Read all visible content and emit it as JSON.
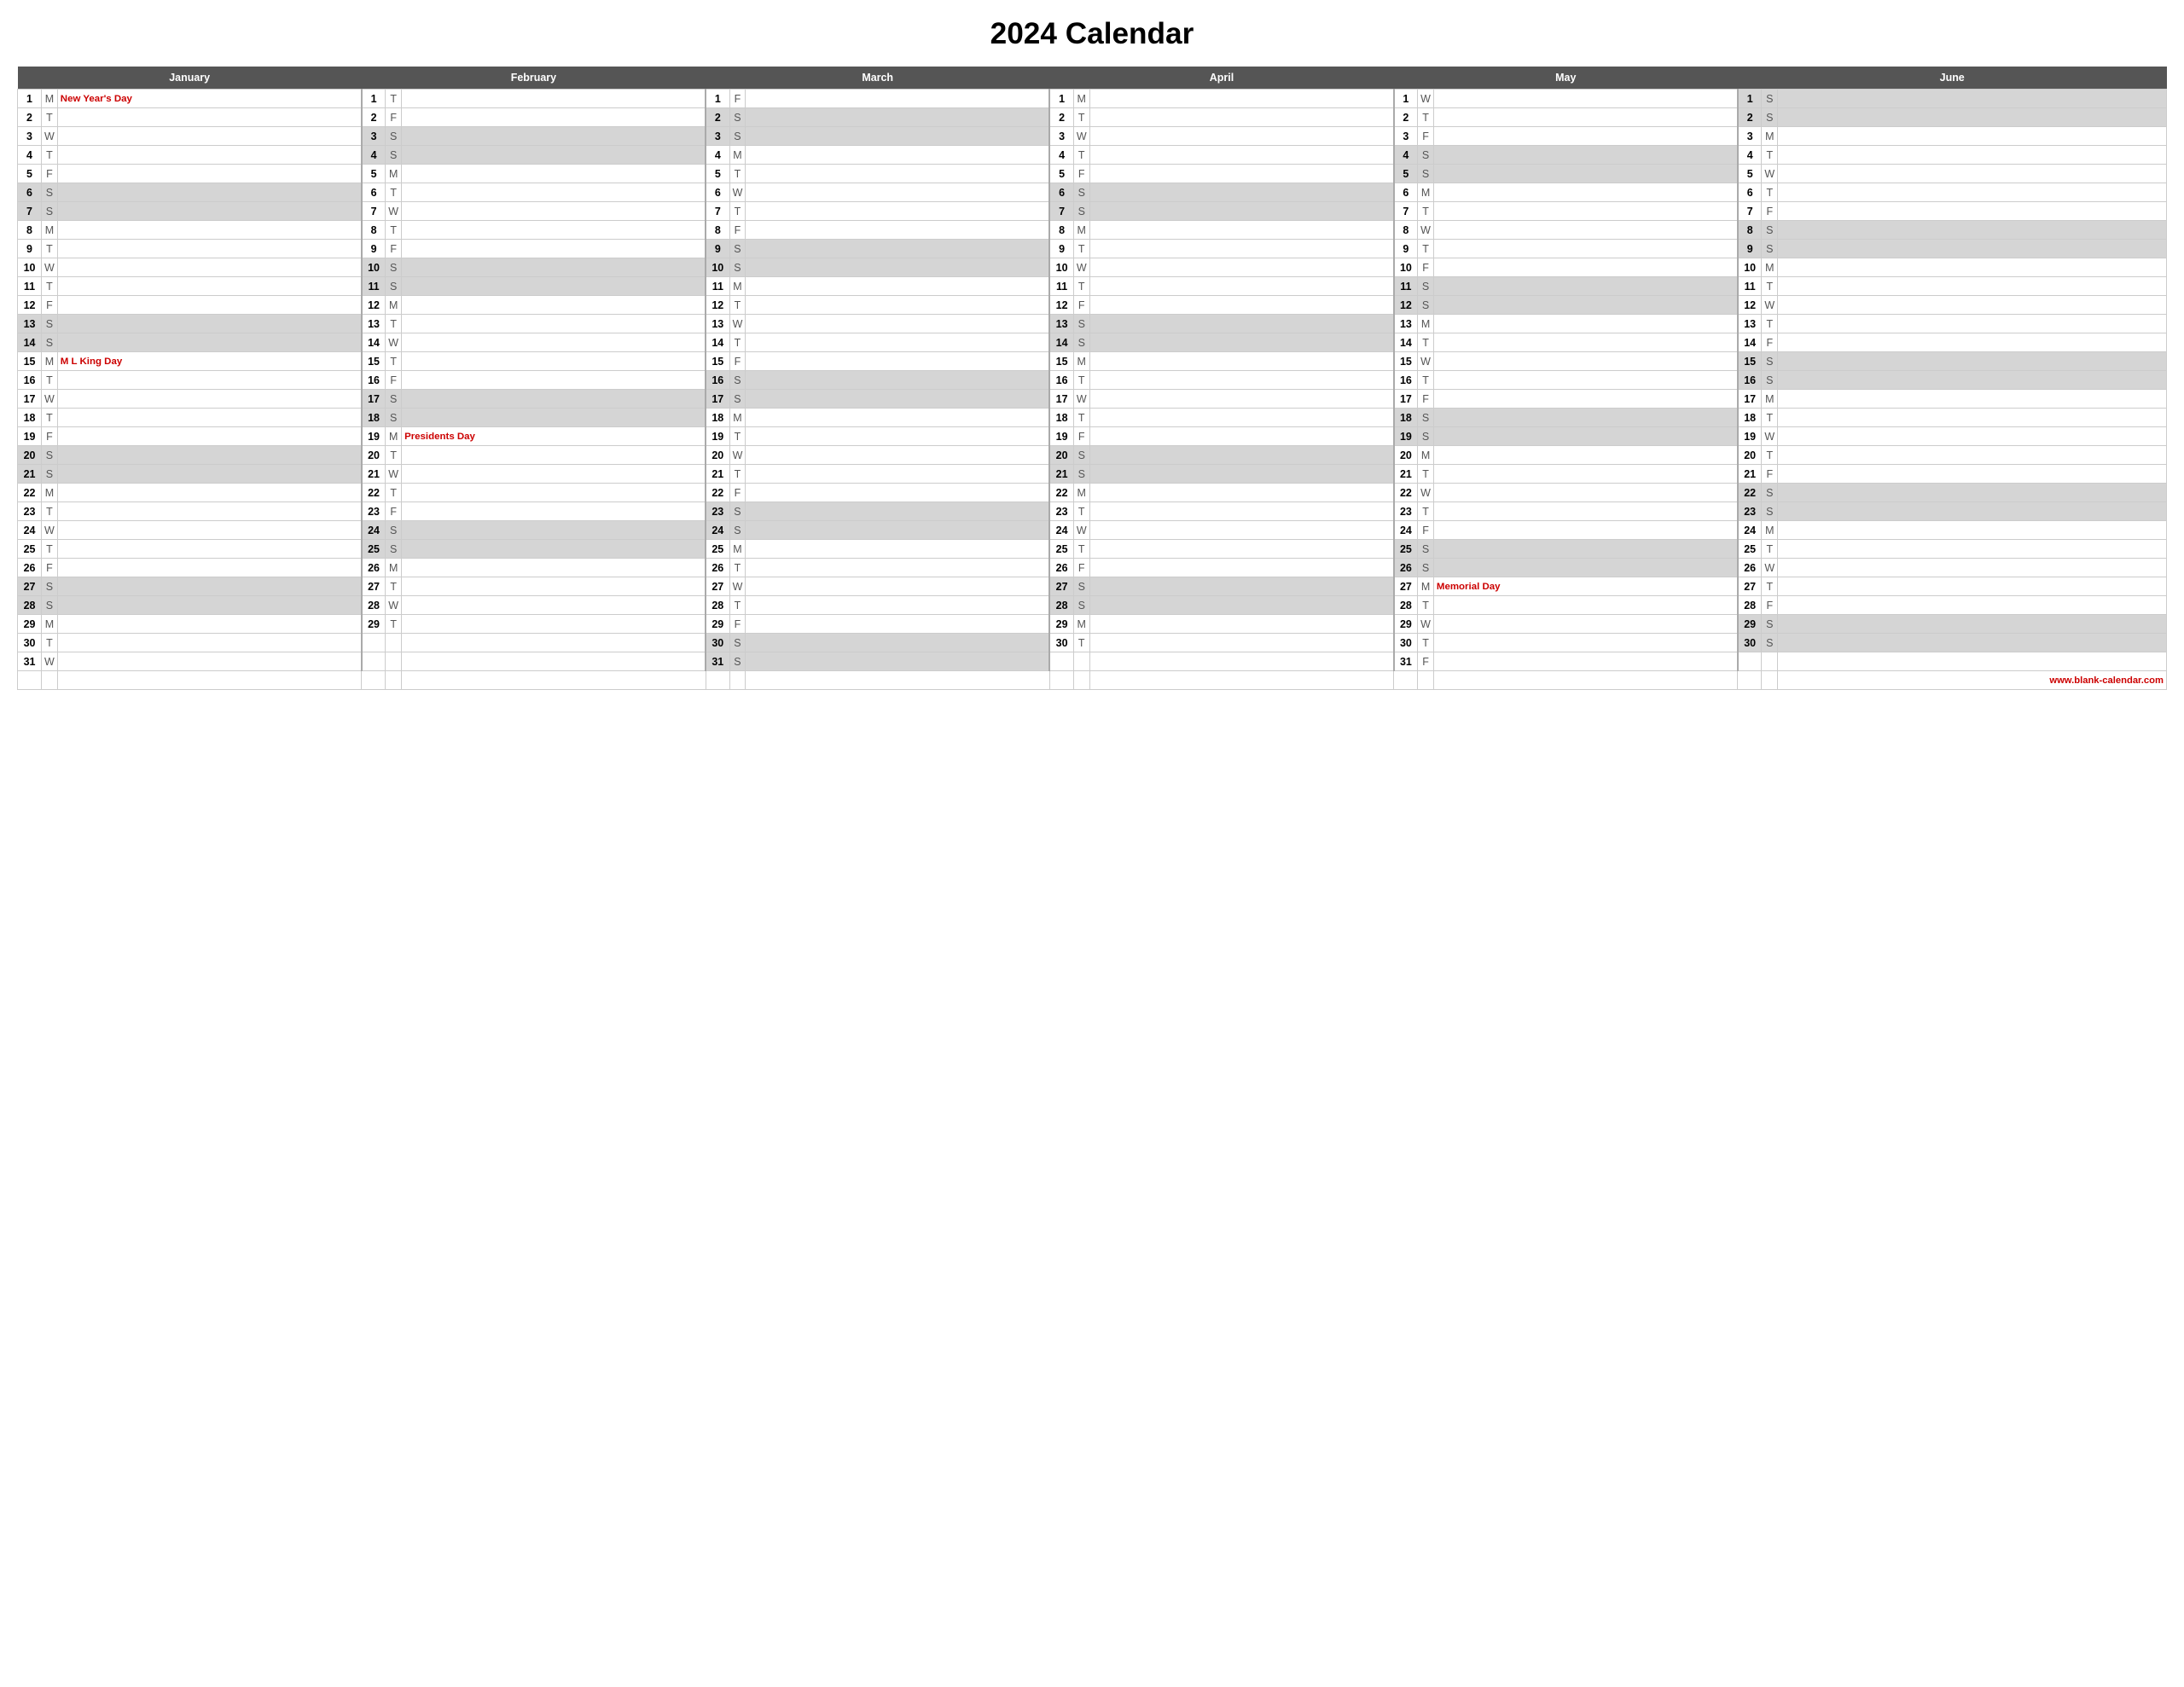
{
  "title": "2024 Calendar",
  "website": "www.blank-calendar.com",
  "months": [
    "January",
    "February",
    "March",
    "April",
    "May",
    "June"
  ],
  "holidays": {
    "jan_1": "New Year's Day",
    "jan_15": "M L King Day",
    "feb_19": "Presidents Day",
    "may_27": "Memorial Day"
  },
  "days": {
    "january": [
      {
        "d": 1,
        "wd": "M",
        "holiday": "New Year's Day",
        "weekend": false
      },
      {
        "d": 2,
        "wd": "T",
        "holiday": "",
        "weekend": false
      },
      {
        "d": 3,
        "wd": "W",
        "holiday": "",
        "weekend": false
      },
      {
        "d": 4,
        "wd": "T",
        "holiday": "",
        "weekend": false
      },
      {
        "d": 5,
        "wd": "F",
        "holiday": "",
        "weekend": false
      },
      {
        "d": 6,
        "wd": "S",
        "holiday": "",
        "weekend": true
      },
      {
        "d": 7,
        "wd": "S",
        "holiday": "",
        "weekend": true
      },
      {
        "d": 8,
        "wd": "M",
        "holiday": "",
        "weekend": false
      },
      {
        "d": 9,
        "wd": "T",
        "holiday": "",
        "weekend": false
      },
      {
        "d": 10,
        "wd": "W",
        "holiday": "",
        "weekend": false
      },
      {
        "d": 11,
        "wd": "T",
        "holiday": "",
        "weekend": false
      },
      {
        "d": 12,
        "wd": "F",
        "holiday": "",
        "weekend": false
      },
      {
        "d": 13,
        "wd": "S",
        "holiday": "",
        "weekend": true
      },
      {
        "d": 14,
        "wd": "S",
        "holiday": "",
        "weekend": true
      },
      {
        "d": 15,
        "wd": "M",
        "holiday": "M L King Day",
        "weekend": false
      },
      {
        "d": 16,
        "wd": "T",
        "holiday": "",
        "weekend": false
      },
      {
        "d": 17,
        "wd": "W",
        "holiday": "",
        "weekend": false
      },
      {
        "d": 18,
        "wd": "T",
        "holiday": "",
        "weekend": false
      },
      {
        "d": 19,
        "wd": "F",
        "holiday": "",
        "weekend": false
      },
      {
        "d": 20,
        "wd": "S",
        "holiday": "",
        "weekend": true
      },
      {
        "d": 21,
        "wd": "S",
        "holiday": "",
        "weekend": true
      },
      {
        "d": 22,
        "wd": "M",
        "holiday": "",
        "weekend": false
      },
      {
        "d": 23,
        "wd": "T",
        "holiday": "",
        "weekend": false
      },
      {
        "d": 24,
        "wd": "W",
        "holiday": "",
        "weekend": false
      },
      {
        "d": 25,
        "wd": "T",
        "holiday": "",
        "weekend": false
      },
      {
        "d": 26,
        "wd": "F",
        "holiday": "",
        "weekend": false
      },
      {
        "d": 27,
        "wd": "S",
        "holiday": "",
        "weekend": true
      },
      {
        "d": 28,
        "wd": "S",
        "holiday": "",
        "weekend": true
      },
      {
        "d": 29,
        "wd": "M",
        "holiday": "",
        "weekend": false
      },
      {
        "d": 30,
        "wd": "T",
        "holiday": "",
        "weekend": false
      },
      {
        "d": 31,
        "wd": "W",
        "holiday": "",
        "weekend": false
      }
    ],
    "february": [
      {
        "d": 1,
        "wd": "T",
        "holiday": "",
        "weekend": false
      },
      {
        "d": 2,
        "wd": "F",
        "holiday": "",
        "weekend": false
      },
      {
        "d": 3,
        "wd": "S",
        "holiday": "",
        "weekend": true
      },
      {
        "d": 4,
        "wd": "S",
        "holiday": "",
        "weekend": true
      },
      {
        "d": 5,
        "wd": "M",
        "holiday": "",
        "weekend": false
      },
      {
        "d": 6,
        "wd": "T",
        "holiday": "",
        "weekend": false
      },
      {
        "d": 7,
        "wd": "W",
        "holiday": "",
        "weekend": false
      },
      {
        "d": 8,
        "wd": "T",
        "holiday": "",
        "weekend": false
      },
      {
        "d": 9,
        "wd": "F",
        "holiday": "",
        "weekend": false
      },
      {
        "d": 10,
        "wd": "S",
        "holiday": "",
        "weekend": true
      },
      {
        "d": 11,
        "wd": "S",
        "holiday": "",
        "weekend": true
      },
      {
        "d": 12,
        "wd": "M",
        "holiday": "",
        "weekend": false
      },
      {
        "d": 13,
        "wd": "T",
        "holiday": "",
        "weekend": false
      },
      {
        "d": 14,
        "wd": "W",
        "holiday": "",
        "weekend": false
      },
      {
        "d": 15,
        "wd": "T",
        "holiday": "",
        "weekend": false
      },
      {
        "d": 16,
        "wd": "F",
        "holiday": "",
        "weekend": false
      },
      {
        "d": 17,
        "wd": "S",
        "holiday": "",
        "weekend": true
      },
      {
        "d": 18,
        "wd": "S",
        "holiday": "",
        "weekend": true
      },
      {
        "d": 19,
        "wd": "M",
        "holiday": "Presidents Day",
        "weekend": false
      },
      {
        "d": 20,
        "wd": "T",
        "holiday": "",
        "weekend": false
      },
      {
        "d": 21,
        "wd": "W",
        "holiday": "",
        "weekend": false
      },
      {
        "d": 22,
        "wd": "T",
        "holiday": "",
        "weekend": false
      },
      {
        "d": 23,
        "wd": "F",
        "holiday": "",
        "weekend": false
      },
      {
        "d": 24,
        "wd": "S",
        "holiday": "",
        "weekend": true
      },
      {
        "d": 25,
        "wd": "S",
        "holiday": "",
        "weekend": true
      },
      {
        "d": 26,
        "wd": "M",
        "holiday": "",
        "weekend": false
      },
      {
        "d": 27,
        "wd": "T",
        "holiday": "",
        "weekend": false
      },
      {
        "d": 28,
        "wd": "W",
        "holiday": "",
        "weekend": false
      },
      {
        "d": 29,
        "wd": "T",
        "holiday": "",
        "weekend": false
      }
    ],
    "march": [
      {
        "d": 1,
        "wd": "F",
        "holiday": "",
        "weekend": false
      },
      {
        "d": 2,
        "wd": "S",
        "holiday": "",
        "weekend": true
      },
      {
        "d": 3,
        "wd": "S",
        "holiday": "",
        "weekend": true
      },
      {
        "d": 4,
        "wd": "M",
        "holiday": "",
        "weekend": false
      },
      {
        "d": 5,
        "wd": "T",
        "holiday": "",
        "weekend": false
      },
      {
        "d": 6,
        "wd": "W",
        "holiday": "",
        "weekend": false
      },
      {
        "d": 7,
        "wd": "T",
        "holiday": "",
        "weekend": false
      },
      {
        "d": 8,
        "wd": "F",
        "holiday": "",
        "weekend": false
      },
      {
        "d": 9,
        "wd": "S",
        "holiday": "",
        "weekend": true
      },
      {
        "d": 10,
        "wd": "S",
        "holiday": "",
        "weekend": true
      },
      {
        "d": 11,
        "wd": "M",
        "holiday": "",
        "weekend": false
      },
      {
        "d": 12,
        "wd": "T",
        "holiday": "",
        "weekend": false
      },
      {
        "d": 13,
        "wd": "W",
        "holiday": "",
        "weekend": false
      },
      {
        "d": 14,
        "wd": "T",
        "holiday": "",
        "weekend": false
      },
      {
        "d": 15,
        "wd": "F",
        "holiday": "",
        "weekend": false
      },
      {
        "d": 16,
        "wd": "S",
        "holiday": "",
        "weekend": true
      },
      {
        "d": 17,
        "wd": "S",
        "holiday": "",
        "weekend": true
      },
      {
        "d": 18,
        "wd": "M",
        "holiday": "",
        "weekend": false
      },
      {
        "d": 19,
        "wd": "T",
        "holiday": "",
        "weekend": false
      },
      {
        "d": 20,
        "wd": "W",
        "holiday": "",
        "weekend": false
      },
      {
        "d": 21,
        "wd": "T",
        "holiday": "",
        "weekend": false
      },
      {
        "d": 22,
        "wd": "F",
        "holiday": "",
        "weekend": false
      },
      {
        "d": 23,
        "wd": "S",
        "holiday": "",
        "weekend": true
      },
      {
        "d": 24,
        "wd": "S",
        "holiday": "",
        "weekend": true
      },
      {
        "d": 25,
        "wd": "M",
        "holiday": "",
        "weekend": false
      },
      {
        "d": 26,
        "wd": "T",
        "holiday": "",
        "weekend": false
      },
      {
        "d": 27,
        "wd": "W",
        "holiday": "",
        "weekend": false
      },
      {
        "d": 28,
        "wd": "T",
        "holiday": "",
        "weekend": false
      },
      {
        "d": 29,
        "wd": "F",
        "holiday": "",
        "weekend": false
      },
      {
        "d": 30,
        "wd": "S",
        "holiday": "",
        "weekend": true
      },
      {
        "d": 31,
        "wd": "S",
        "holiday": "",
        "weekend": true
      }
    ],
    "april": [
      {
        "d": 1,
        "wd": "M",
        "holiday": "",
        "weekend": false
      },
      {
        "d": 2,
        "wd": "T",
        "holiday": "",
        "weekend": false
      },
      {
        "d": 3,
        "wd": "W",
        "holiday": "",
        "weekend": false
      },
      {
        "d": 4,
        "wd": "T",
        "holiday": "",
        "weekend": false
      },
      {
        "d": 5,
        "wd": "F",
        "holiday": "",
        "weekend": false
      },
      {
        "d": 6,
        "wd": "S",
        "holiday": "",
        "weekend": true
      },
      {
        "d": 7,
        "wd": "S",
        "holiday": "",
        "weekend": true
      },
      {
        "d": 8,
        "wd": "M",
        "holiday": "",
        "weekend": false
      },
      {
        "d": 9,
        "wd": "T",
        "holiday": "",
        "weekend": false
      },
      {
        "d": 10,
        "wd": "W",
        "holiday": "",
        "weekend": false
      },
      {
        "d": 11,
        "wd": "T",
        "holiday": "",
        "weekend": false
      },
      {
        "d": 12,
        "wd": "F",
        "holiday": "",
        "weekend": false
      },
      {
        "d": 13,
        "wd": "S",
        "holiday": "",
        "weekend": true
      },
      {
        "d": 14,
        "wd": "S",
        "holiday": "",
        "weekend": true
      },
      {
        "d": 15,
        "wd": "M",
        "holiday": "",
        "weekend": false
      },
      {
        "d": 16,
        "wd": "T",
        "holiday": "",
        "weekend": false
      },
      {
        "d": 17,
        "wd": "W",
        "holiday": "",
        "weekend": false
      },
      {
        "d": 18,
        "wd": "T",
        "holiday": "",
        "weekend": false
      },
      {
        "d": 19,
        "wd": "F",
        "holiday": "",
        "weekend": false
      },
      {
        "d": 20,
        "wd": "S",
        "holiday": "",
        "weekend": true
      },
      {
        "d": 21,
        "wd": "S",
        "holiday": "",
        "weekend": true
      },
      {
        "d": 22,
        "wd": "M",
        "holiday": "",
        "weekend": false
      },
      {
        "d": 23,
        "wd": "T",
        "holiday": "",
        "weekend": false
      },
      {
        "d": 24,
        "wd": "W",
        "holiday": "",
        "weekend": false
      },
      {
        "d": 25,
        "wd": "T",
        "holiday": "",
        "weekend": false
      },
      {
        "d": 26,
        "wd": "F",
        "holiday": "",
        "weekend": false
      },
      {
        "d": 27,
        "wd": "S",
        "holiday": "",
        "weekend": true
      },
      {
        "d": 28,
        "wd": "S",
        "holiday": "",
        "weekend": true
      },
      {
        "d": 29,
        "wd": "M",
        "holiday": "",
        "weekend": false
      },
      {
        "d": 30,
        "wd": "T",
        "holiday": "",
        "weekend": false
      }
    ],
    "may": [
      {
        "d": 1,
        "wd": "W",
        "holiday": "",
        "weekend": false
      },
      {
        "d": 2,
        "wd": "T",
        "holiday": "",
        "weekend": false
      },
      {
        "d": 3,
        "wd": "F",
        "holiday": "",
        "weekend": false
      },
      {
        "d": 4,
        "wd": "S",
        "holiday": "",
        "weekend": true
      },
      {
        "d": 5,
        "wd": "S",
        "holiday": "",
        "weekend": true
      },
      {
        "d": 6,
        "wd": "M",
        "holiday": "",
        "weekend": false
      },
      {
        "d": 7,
        "wd": "T",
        "holiday": "",
        "weekend": false
      },
      {
        "d": 8,
        "wd": "W",
        "holiday": "",
        "weekend": false
      },
      {
        "d": 9,
        "wd": "T",
        "holiday": "",
        "weekend": false
      },
      {
        "d": 10,
        "wd": "F",
        "holiday": "",
        "weekend": false
      },
      {
        "d": 11,
        "wd": "S",
        "holiday": "",
        "weekend": true
      },
      {
        "d": 12,
        "wd": "S",
        "holiday": "",
        "weekend": true
      },
      {
        "d": 13,
        "wd": "M",
        "holiday": "",
        "weekend": false
      },
      {
        "d": 14,
        "wd": "T",
        "holiday": "",
        "weekend": false
      },
      {
        "d": 15,
        "wd": "W",
        "holiday": "",
        "weekend": false
      },
      {
        "d": 16,
        "wd": "T",
        "holiday": "",
        "weekend": false
      },
      {
        "d": 17,
        "wd": "F",
        "holiday": "",
        "weekend": false
      },
      {
        "d": 18,
        "wd": "S",
        "holiday": "",
        "weekend": true
      },
      {
        "d": 19,
        "wd": "S",
        "holiday": "",
        "weekend": true
      },
      {
        "d": 20,
        "wd": "M",
        "holiday": "",
        "weekend": false
      },
      {
        "d": 21,
        "wd": "T",
        "holiday": "",
        "weekend": false
      },
      {
        "d": 22,
        "wd": "W",
        "holiday": "",
        "weekend": false
      },
      {
        "d": 23,
        "wd": "T",
        "holiday": "",
        "weekend": false
      },
      {
        "d": 24,
        "wd": "F",
        "holiday": "",
        "weekend": false
      },
      {
        "d": 25,
        "wd": "S",
        "holiday": "",
        "weekend": true
      },
      {
        "d": 26,
        "wd": "S",
        "holiday": "",
        "weekend": true
      },
      {
        "d": 27,
        "wd": "M",
        "holiday": "Memorial Day",
        "weekend": false
      },
      {
        "d": 28,
        "wd": "T",
        "holiday": "",
        "weekend": false
      },
      {
        "d": 29,
        "wd": "W",
        "holiday": "",
        "weekend": false
      },
      {
        "d": 30,
        "wd": "T",
        "holiday": "",
        "weekend": false
      },
      {
        "d": 31,
        "wd": "F",
        "holiday": "",
        "weekend": false
      }
    ],
    "june": [
      {
        "d": 1,
        "wd": "S",
        "holiday": "",
        "weekend": true
      },
      {
        "d": 2,
        "wd": "S",
        "holiday": "",
        "weekend": true
      },
      {
        "d": 3,
        "wd": "M",
        "holiday": "",
        "weekend": false
      },
      {
        "d": 4,
        "wd": "T",
        "holiday": "",
        "weekend": false
      },
      {
        "d": 5,
        "wd": "W",
        "holiday": "",
        "weekend": false
      },
      {
        "d": 6,
        "wd": "T",
        "holiday": "",
        "weekend": false
      },
      {
        "d": 7,
        "wd": "F",
        "holiday": "",
        "weekend": false
      },
      {
        "d": 8,
        "wd": "S",
        "holiday": "",
        "weekend": true
      },
      {
        "d": 9,
        "wd": "S",
        "holiday": "",
        "weekend": true
      },
      {
        "d": 10,
        "wd": "M",
        "holiday": "",
        "weekend": false
      },
      {
        "d": 11,
        "wd": "T",
        "holiday": "",
        "weekend": false
      },
      {
        "d": 12,
        "wd": "W",
        "holiday": "",
        "weekend": false
      },
      {
        "d": 13,
        "wd": "T",
        "holiday": "",
        "weekend": false
      },
      {
        "d": 14,
        "wd": "F",
        "holiday": "",
        "weekend": false
      },
      {
        "d": 15,
        "wd": "S",
        "holiday": "",
        "weekend": true
      },
      {
        "d": 16,
        "wd": "S",
        "holiday": "",
        "weekend": true
      },
      {
        "d": 17,
        "wd": "M",
        "holiday": "",
        "weekend": false
      },
      {
        "d": 18,
        "wd": "T",
        "holiday": "",
        "weekend": false
      },
      {
        "d": 19,
        "wd": "W",
        "holiday": "",
        "weekend": false
      },
      {
        "d": 20,
        "wd": "T",
        "holiday": "",
        "weekend": false
      },
      {
        "d": 21,
        "wd": "F",
        "holiday": "",
        "weekend": false
      },
      {
        "d": 22,
        "wd": "S",
        "holiday": "",
        "weekend": true
      },
      {
        "d": 23,
        "wd": "S",
        "holiday": "",
        "weekend": true
      },
      {
        "d": 24,
        "wd": "M",
        "holiday": "",
        "weekend": false
      },
      {
        "d": 25,
        "wd": "T",
        "holiday": "",
        "weekend": false
      },
      {
        "d": 26,
        "wd": "W",
        "holiday": "",
        "weekend": false
      },
      {
        "d": 27,
        "wd": "T",
        "holiday": "",
        "weekend": false
      },
      {
        "d": 28,
        "wd": "F",
        "holiday": "",
        "weekend": false
      },
      {
        "d": 29,
        "wd": "S",
        "holiday": "",
        "weekend": true
      },
      {
        "d": 30,
        "wd": "S",
        "holiday": "",
        "weekend": true
      }
    ]
  }
}
